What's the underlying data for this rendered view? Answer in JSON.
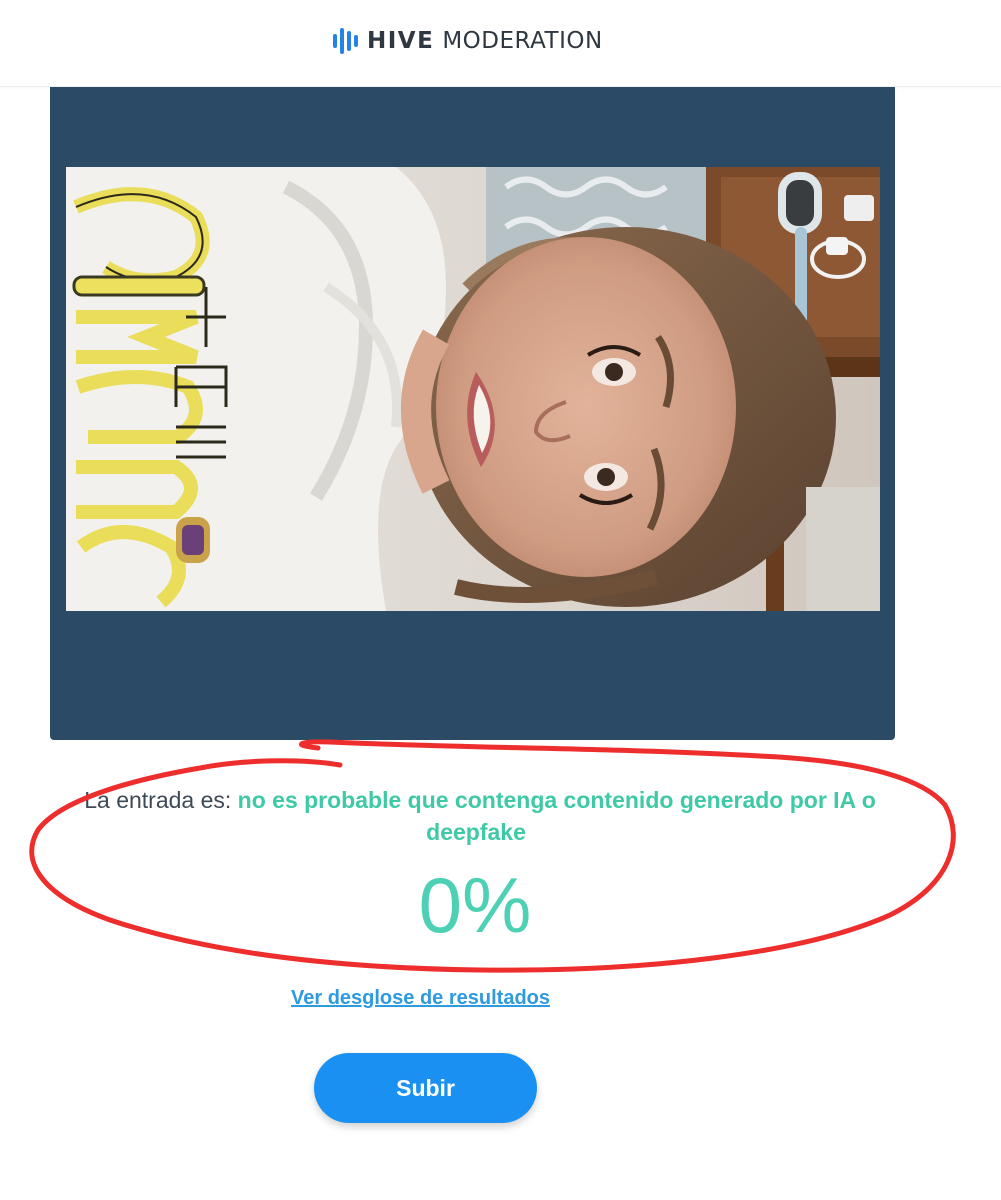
{
  "header": {
    "brand_bold": "HIVE",
    "brand_light": "MODERATION",
    "logo_icon": "hive-bars-icon",
    "brand_color": "#2f3740",
    "icon_color": "#2583e6"
  },
  "preview": {
    "panel_color": "#2a4a66",
    "photo_text": "THE SIMPSONS"
  },
  "result": {
    "label": "La entrada es:",
    "verdict_line1": "no es probable que contenga contenido generado por IA o",
    "verdict_line2": "deepfake",
    "percent": "0%",
    "percent_value": 0,
    "verdict_color": "#3fc9a6"
  },
  "actions": {
    "breakdown_link": "Ver desglose de resultados",
    "upload_button": "Subir",
    "accent_color": "#1a90f2"
  },
  "annotation": {
    "color": "#ee2d2d"
  }
}
